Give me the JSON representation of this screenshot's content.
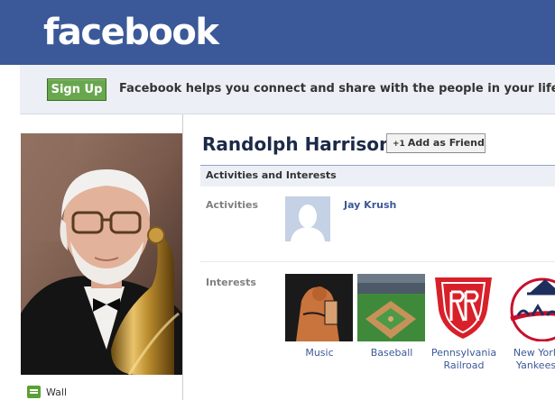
{
  "header": {
    "logo": "facebook"
  },
  "signup": {
    "button_label": "Sign Up",
    "tagline": "Facebook helps you connect and share with the people in your life."
  },
  "profile": {
    "name": "Randolph Harrison",
    "add_friend_label": "Add as Friend",
    "add_friend_icon": "+1",
    "wall_label": "Wall"
  },
  "sections": {
    "activities_interests": {
      "title": "Activities and Interests",
      "activities_label": "Activities",
      "interests_label": "Interests",
      "activities": [
        {
          "name": "Jay Krush"
        }
      ],
      "interests": [
        {
          "name": "Music",
          "icon": "music-thumb"
        },
        {
          "name": "Baseball",
          "icon": "baseball-thumb"
        },
        {
          "name": "Pennsylvania Railroad",
          "icon": "prr-logo"
        },
        {
          "name": "New York Yankees",
          "icon": "yankees-logo"
        }
      ]
    }
  },
  "colors": {
    "brand_blue": "#3b5998",
    "signup_green": "#69a74e",
    "link_blue": "#3b5998",
    "section_bg": "#eceff5"
  }
}
